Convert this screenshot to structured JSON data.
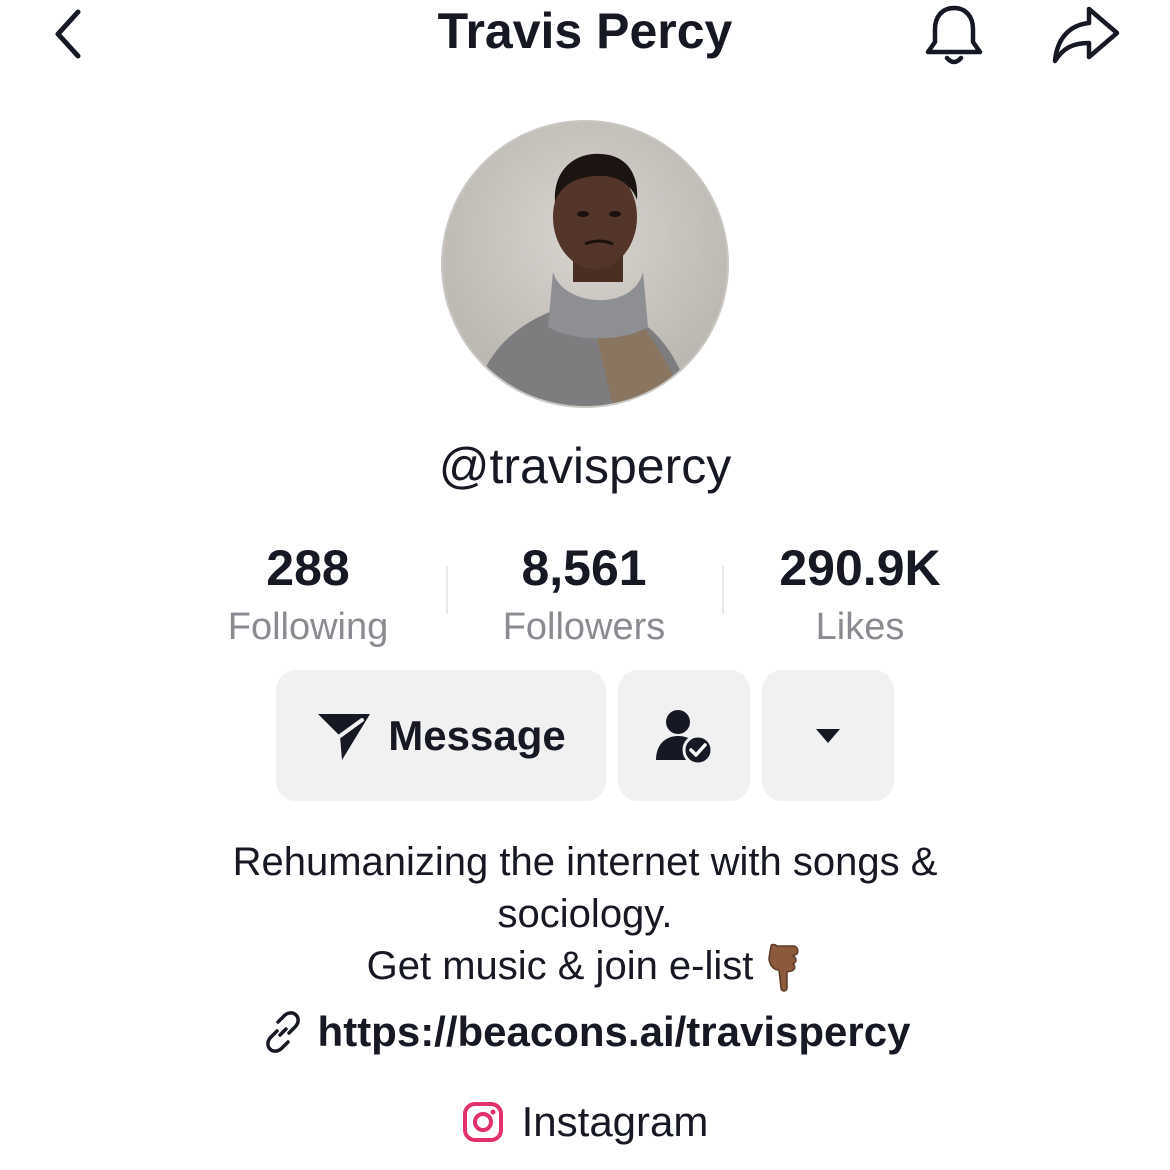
{
  "header": {
    "title": "Travis Percy",
    "back_icon": "chevron-left-icon",
    "bell_icon": "bell-icon",
    "share_icon": "share-icon"
  },
  "profile": {
    "username": "@travispercy",
    "avatar": "profile-photo"
  },
  "stats": [
    {
      "value": "288",
      "label": "Following"
    },
    {
      "value": "8,561",
      "label": "Followers"
    },
    {
      "value": "290.9K",
      "label": "Likes"
    }
  ],
  "actions": {
    "message_label": "Message",
    "message_icon": "send-icon",
    "friend_icon": "user-check-icon",
    "more_icon": "caret-down-icon"
  },
  "bio": {
    "line1": "Rehumanizing the internet with songs &",
    "line2": "sociology.",
    "line3": "Get music & join e-list",
    "emoji": "pointing-down-hand-icon"
  },
  "link": {
    "url": "https://beacons.ai/travispercy",
    "icon": "link-icon"
  },
  "instagram": {
    "label": "Instagram",
    "icon": "instagram-icon",
    "color": "#e1306c"
  }
}
